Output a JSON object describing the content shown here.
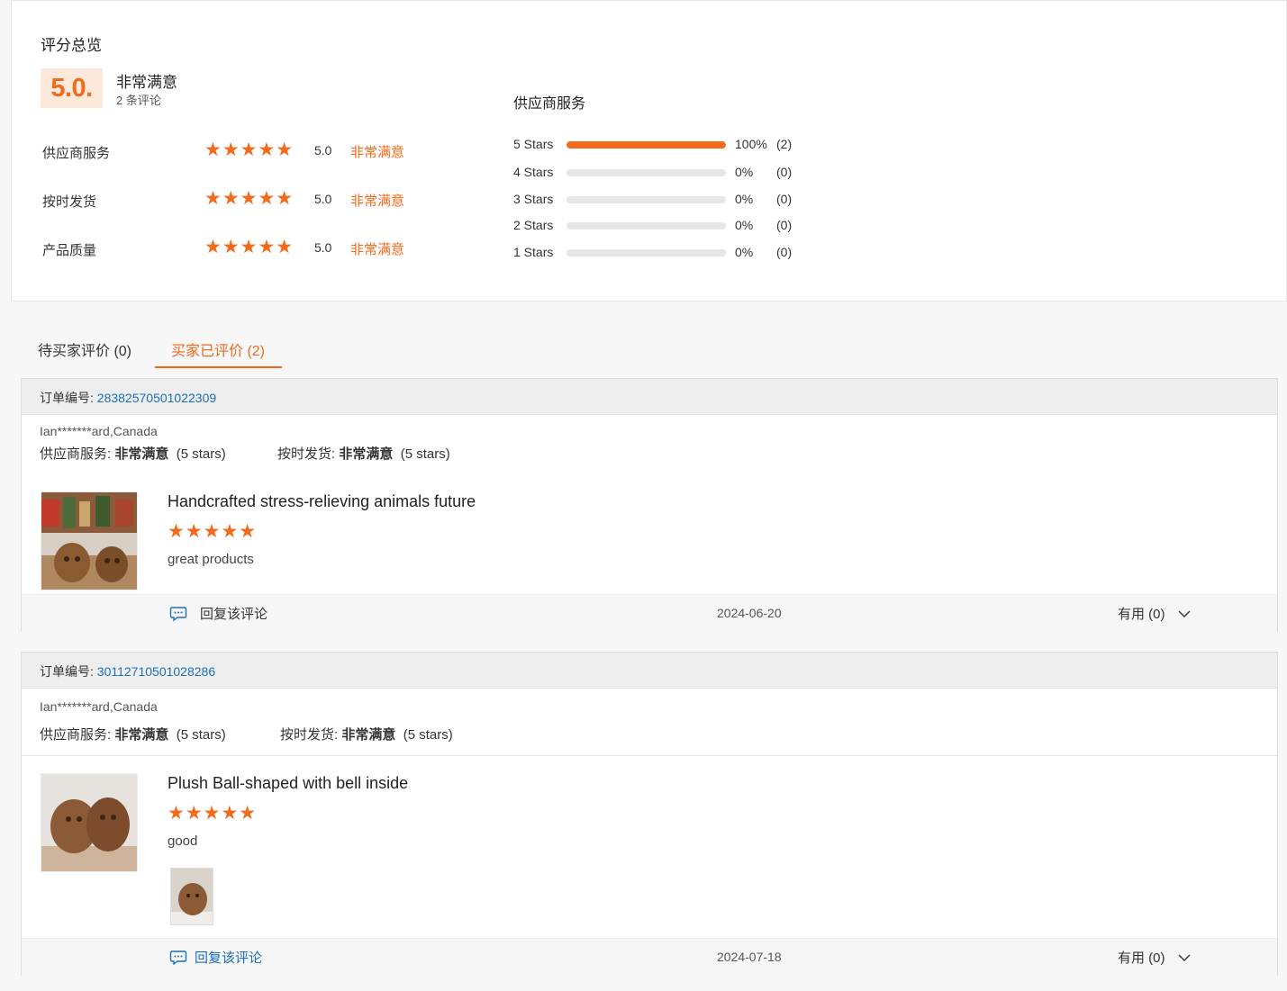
{
  "overview": {
    "title": "评分总览",
    "score": "5.0.",
    "score_label": "非常满意",
    "review_count": "2 条评论",
    "categories": [
      {
        "name": "供应商服务",
        "stars": "★★★★★",
        "score": "5.0",
        "label": "非常满意"
      },
      {
        "name": "按时发货",
        "stars": "★★★★★",
        "score": "5.0",
        "label": "非常满意"
      },
      {
        "name": "产品质量",
        "stars": "★★★★★",
        "score": "5.0",
        "label": "非常满意"
      }
    ],
    "distribution_title": "供应商服务",
    "distribution": [
      {
        "label": "5 Stars",
        "fraction": 1.0,
        "percent": "100%",
        "count": "(2)"
      },
      {
        "label": "4 Stars",
        "fraction": 0.0,
        "percent": "0%",
        "count": "(0)"
      },
      {
        "label": "3 Stars",
        "fraction": 0.0,
        "percent": "0%",
        "count": "(0)"
      },
      {
        "label": "2 Stars",
        "fraction": 0.0,
        "percent": "0%",
        "count": "(0)"
      },
      {
        "label": "1 Stars",
        "fraction": 0.0,
        "percent": "0%",
        "count": "(0)"
      }
    ]
  },
  "tabs": [
    {
      "label": "待买家评价 (0)",
      "active": false
    },
    {
      "label": "买家已评价 (2)",
      "active": true
    }
  ],
  "reviews": [
    {
      "order_label": "订单编号:",
      "order_id": "28382570501022309",
      "buyer": "Ian*******ard,Canada",
      "service_label": "供应商服务:",
      "service_value": "非常满意",
      "service_stars": "(5 stars)",
      "shipping_label": "按时发货:",
      "shipping_value": "非常满意",
      "shipping_stars": "(5 stars)",
      "product_title": "Handcrafted stress-relieving animals future",
      "stars": "★★★★★",
      "text": "great products",
      "reply": "回复该评论",
      "date": "2024-06-20",
      "helpful": "有用 (0)"
    },
    {
      "order_label": "订单编号:",
      "order_id": "30112710501028286",
      "buyer": "Ian*******ard,Canada",
      "service_label": "供应商服务:",
      "service_value": "非常满意",
      "service_stars": "(5 stars)",
      "shipping_label": "按时发货:",
      "shipping_value": "非常满意",
      "shipping_stars": "(5 stars)",
      "product_title": "Plush Ball-shaped with bell inside",
      "stars": "★★★★★",
      "text": "good",
      "reply": "回复该评论",
      "date": "2024-07-18",
      "helpful": "有用 (0)"
    }
  ],
  "colors": {
    "accent": "#f26a1b",
    "link": "#1a6fb5"
  }
}
